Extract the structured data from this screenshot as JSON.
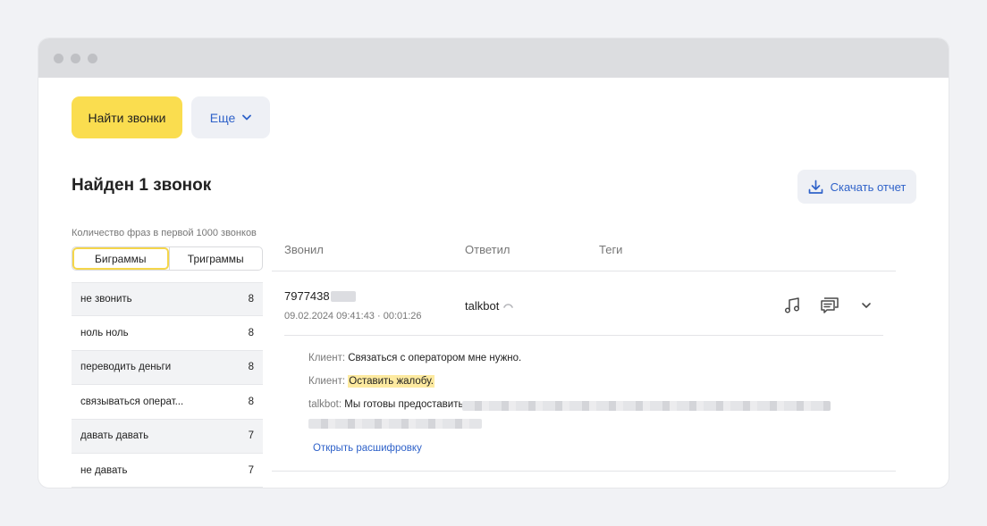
{
  "toolbar": {
    "find_calls": "Найти звонки",
    "more": "Еще"
  },
  "results": {
    "title": "Найден 1 звонок",
    "download_report": "Скачать отчет"
  },
  "phrases": {
    "caption": "Количество фраз в первой 1000 звонков",
    "tabs": [
      "Биграммы",
      "Триграммы"
    ],
    "active_tab": "Биграммы",
    "items": [
      {
        "text": "не звонить",
        "count": "8"
      },
      {
        "text": "ноль ноль",
        "count": "8"
      },
      {
        "text": "переводить деньги",
        "count": "8"
      },
      {
        "text": "связываться операт...",
        "count": "8"
      },
      {
        "text": "давать давать",
        "count": "7"
      },
      {
        "text": "не давать",
        "count": "7"
      }
    ]
  },
  "table": {
    "columns": [
      "Звонил",
      "Ответил",
      "Теги"
    ],
    "call": {
      "caller": "7977438",
      "datetime": "09.02.2024 09:41:43 · 00:01:26",
      "answered": "talkbot"
    }
  },
  "transcript": {
    "lines": [
      {
        "speaker": "Клиент:",
        "text": "Связаться с оператором мне нужно."
      },
      {
        "speaker": "Клиент:",
        "text": "Оставить жалобу."
      },
      {
        "speaker": "talkbot:",
        "text": "Мы готовы предоставить"
      }
    ],
    "open_link": "Открыть расшифровку"
  },
  "icons": {
    "chevron": "chevron-down-icon",
    "download": "download-icon",
    "audio": "music-note-icon",
    "transcript": "chat-transcript-icon",
    "expand": "expand-chevron-icon",
    "hangup": "hangup-icon"
  },
  "colors": {
    "accent_yellow": "#fadd4f",
    "link_blue": "#2f62c9",
    "highlight": "#fdeaa0"
  }
}
